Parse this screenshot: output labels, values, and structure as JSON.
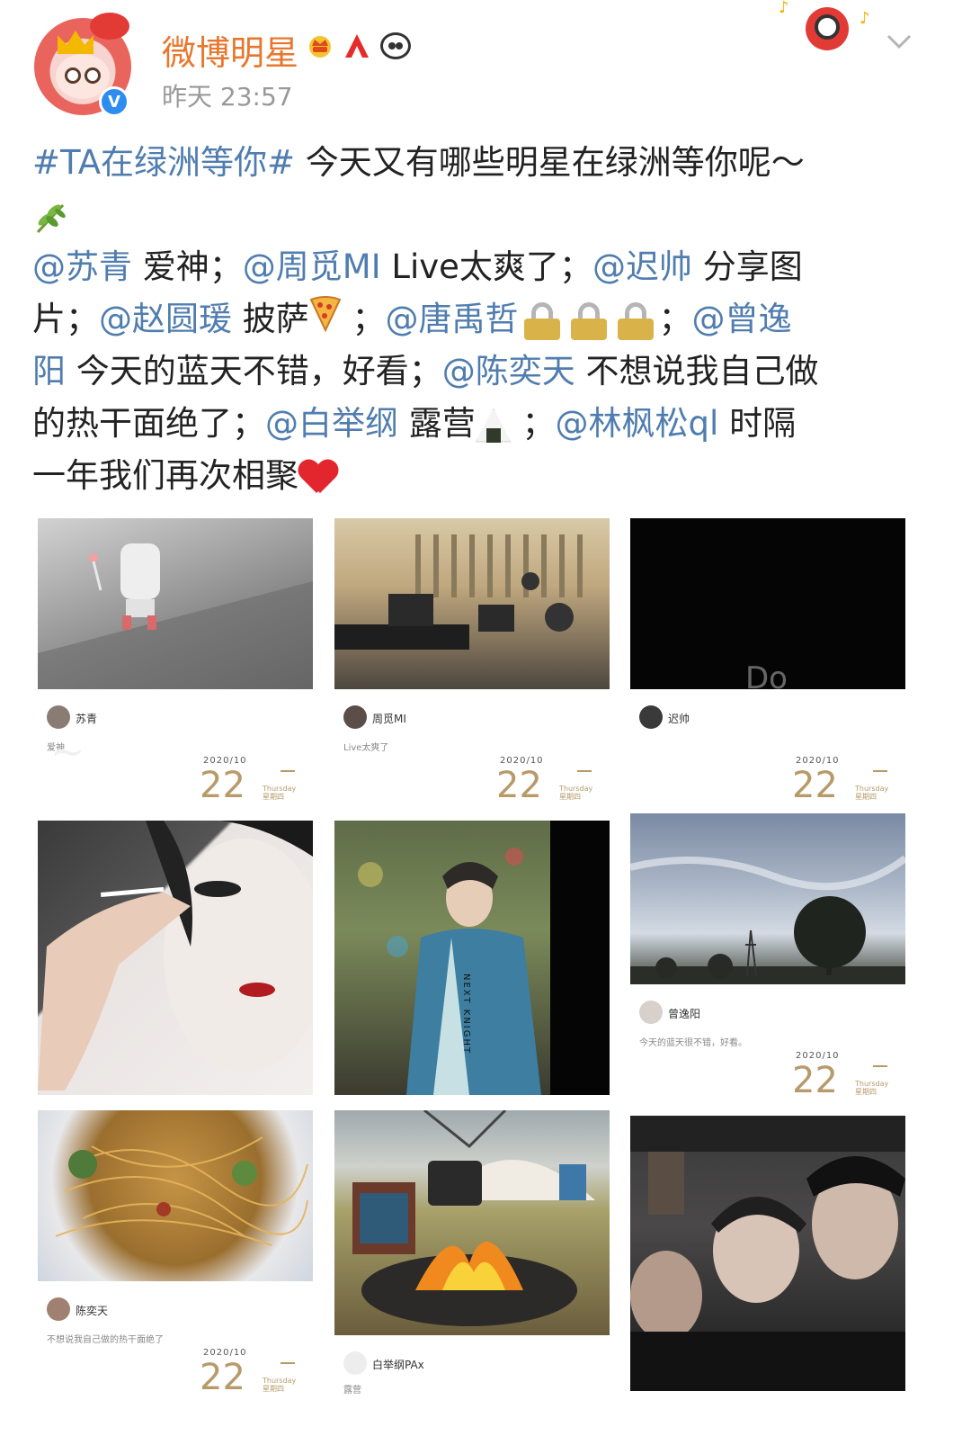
{
  "post": {
    "username": "微博明星",
    "timestamp": "昨天 23:57",
    "badges": [
      "crown-badge",
      "a-badge",
      "panda-badge"
    ],
    "verified_mark": "V"
  },
  "content": {
    "line1": {
      "tag": "#TA在绿洲等你#",
      "text": " 今天又有哪些明星在绿洲等你呢～"
    },
    "line3": {
      "m1": "@苏青",
      "t1": " 爱神；",
      "m2": "@周觅MI",
      "t2": " Live太爽了；",
      "m3": "@迟帅",
      "t3": "  分享图"
    },
    "line4": {
      "t1": "片；",
      "m1": "@赵圆瑗",
      "t2": "  披萨",
      "t3": " ；",
      "m2": "@唐禹哲",
      "t4": "；",
      "m3": "@曾逸"
    },
    "line5": {
      "m1": "阳",
      "t1": "  今天的蓝天不错，好看；",
      "m2": "@陈奕天",
      "t2": "  不想说我自己做"
    },
    "line6": {
      "t1": "的热干面绝了；",
      "m1": "@白举纲",
      "t2": "  露营",
      "t3": " ；",
      "m2": "@林枫松ql",
      "t4": "  时隔"
    },
    "line7": {
      "t1": "一年我们再次相聚"
    }
  },
  "cards": [
    {
      "name": "苏青",
      "caption": "爱神",
      "date_small": "2020/10",
      "day": "22",
      "weekday_en": "Thursday",
      "weekday_cn": "星期四"
    },
    {
      "name": "周觅MI",
      "caption": "Live太爽了",
      "date_small": "2020/10",
      "day": "22",
      "weekday_en": "Thursday",
      "weekday_cn": "星期四"
    },
    {
      "name": "迟帅",
      "caption": "",
      "overlay": "Do",
      "date_small": "2020/10",
      "day": "22",
      "weekday_en": "Thursday",
      "weekday_cn": "星期四"
    },
    {
      "name": "曾逸阳",
      "caption": "今天的蓝天很不错，好看。",
      "date_small": "2020/10",
      "day": "22",
      "weekday_en": "Thursday",
      "weekday_cn": "星期四"
    },
    {
      "name": "陈奕天",
      "caption": "不想说我自己做的热干面绝了",
      "date_small": "2020/10",
      "day": "22",
      "weekday_en": "Thursday",
      "weekday_cn": "星期四"
    },
    {
      "name": "白举纲PAx",
      "caption": "露营"
    }
  ],
  "photo_jacket_text": "NEXT KNIGHT",
  "colors": {
    "link": "#507daf",
    "username": "#e8772e",
    "timestamp": "#999999",
    "date_accent": "#b89a6a"
  }
}
